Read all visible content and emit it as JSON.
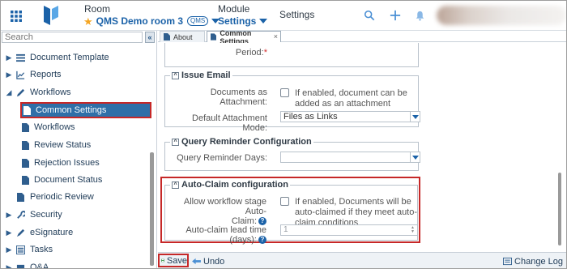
{
  "header": {
    "room_label": "Room",
    "room_name": "QMS Demo room 3",
    "room_badge": "QMS",
    "module_label": "Module",
    "module_name": "Settings",
    "page_title": "Settings",
    "icons": [
      "apps-grid-icon",
      "app-logo",
      "search-icon",
      "plus-icon",
      "bell-icon",
      "user-avatar"
    ]
  },
  "sidebar": {
    "search_placeholder": "Search",
    "collapse_label": "«",
    "items": [
      {
        "label": "Document Template",
        "icon": "list-icon",
        "expanded": false
      },
      {
        "label": "Reports",
        "icon": "chart-icon",
        "expanded": false
      },
      {
        "label": "Workflows",
        "icon": "pencil-icon",
        "expanded": true
      },
      {
        "label": "Periodic Review",
        "icon": "doc-icon",
        "expanded": false
      },
      {
        "label": "Security",
        "icon": "wrench-icon",
        "expanded": false
      },
      {
        "label": "eSignature",
        "icon": "pen-icon",
        "expanded": false
      },
      {
        "label": "Tasks",
        "icon": "list-icon",
        "expanded": false
      },
      {
        "label": "Q&A",
        "icon": "chat-icon",
        "expanded": false
      }
    ],
    "workflow_children": [
      {
        "label": "Common Settings",
        "active": true
      },
      {
        "label": "Workflows",
        "active": false
      },
      {
        "label": "Review Status",
        "active": false
      },
      {
        "label": "Rejection Issues",
        "active": false
      },
      {
        "label": "Document Status",
        "active": false
      }
    ]
  },
  "tabs": [
    {
      "label": "About",
      "active": false
    },
    {
      "label": "Common Settings",
      "active": true,
      "close": "×"
    }
  ],
  "content": {
    "top_panel": {
      "period_label": "Period:",
      "required_mark": "*"
    },
    "issue_email": {
      "title": "Issue Email",
      "toggle": "^",
      "attach_label": "Documents as Attachment:",
      "attach_help": "If enabled, document can be added as an attachment",
      "attach_checked": false,
      "mode_label": "Default Attachment Mode:",
      "mode_value": "Files as Links"
    },
    "query_reminder": {
      "title": "Query Reminder Configuration",
      "toggle": "^",
      "days_label": "Query Reminder Days:",
      "days_value": ""
    },
    "auto_claim": {
      "title": "Auto-Claim configuration",
      "toggle": "^",
      "allow_label_1": "Allow workflow stage Auto-",
      "allow_label_2": "Claim:",
      "allow_help": "If enabled, Documents will be auto-claimed if they meet auto-claim conditions",
      "allow_checked": false,
      "lead_label": "Auto-claim lead time (days):",
      "lead_value": "1",
      "help_icon": "?"
    }
  },
  "footer": {
    "save_label": "Save",
    "undo_label": "Undo",
    "changelog_label": "Change Log"
  },
  "colors": {
    "accent": "#1b62a8",
    "active_bg": "#2f6fa8",
    "highlight_border": "#c62828",
    "star": "#f5a623",
    "required": "#d32f2f"
  }
}
